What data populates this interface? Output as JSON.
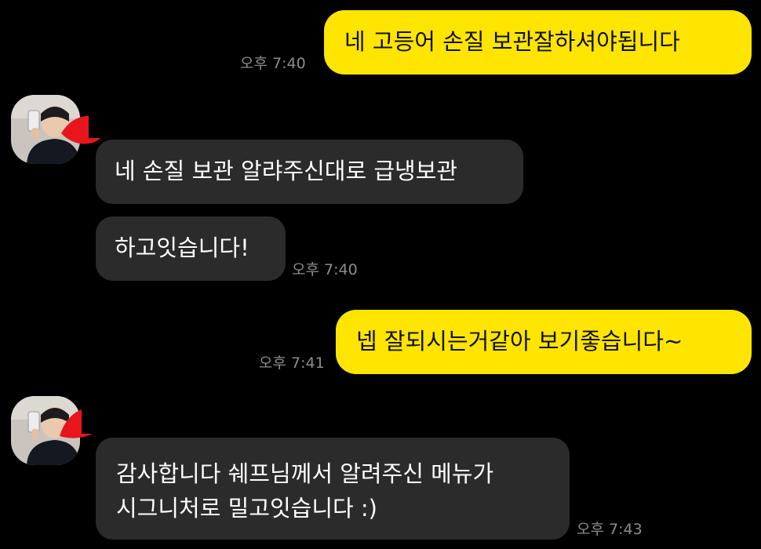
{
  "messages": [
    {
      "from": "me",
      "text": "네 고등어 손질 보관잘하셔야됩니다",
      "time": "오후 7:40"
    },
    {
      "from": "them",
      "lines": [
        "네 손질 보관 알랴주신대로 급냉보관"
      ]
    },
    {
      "from": "them",
      "lines": [
        "하고잇습니다!"
      ],
      "time": "오후 7:40"
    },
    {
      "from": "me",
      "text": "넵  잘되시는거같아 보기좋습니다~",
      "time": "오후 7:41"
    },
    {
      "from": "them",
      "lines": [
        "감사합니다 쉐프님께서 알려주신 메뉴가",
        "시그니처로 밀고잇습니다 :)"
      ],
      "time": "오후 7:43"
    }
  ],
  "colors": {
    "background": "#000000",
    "my_bubble": "#FEE500",
    "their_bubble": "#2B2B2B",
    "timestamp": "#8C8C8C",
    "redaction_red": "#E8151B"
  },
  "icons": {
    "avatar": "profile-photo-avatar"
  }
}
